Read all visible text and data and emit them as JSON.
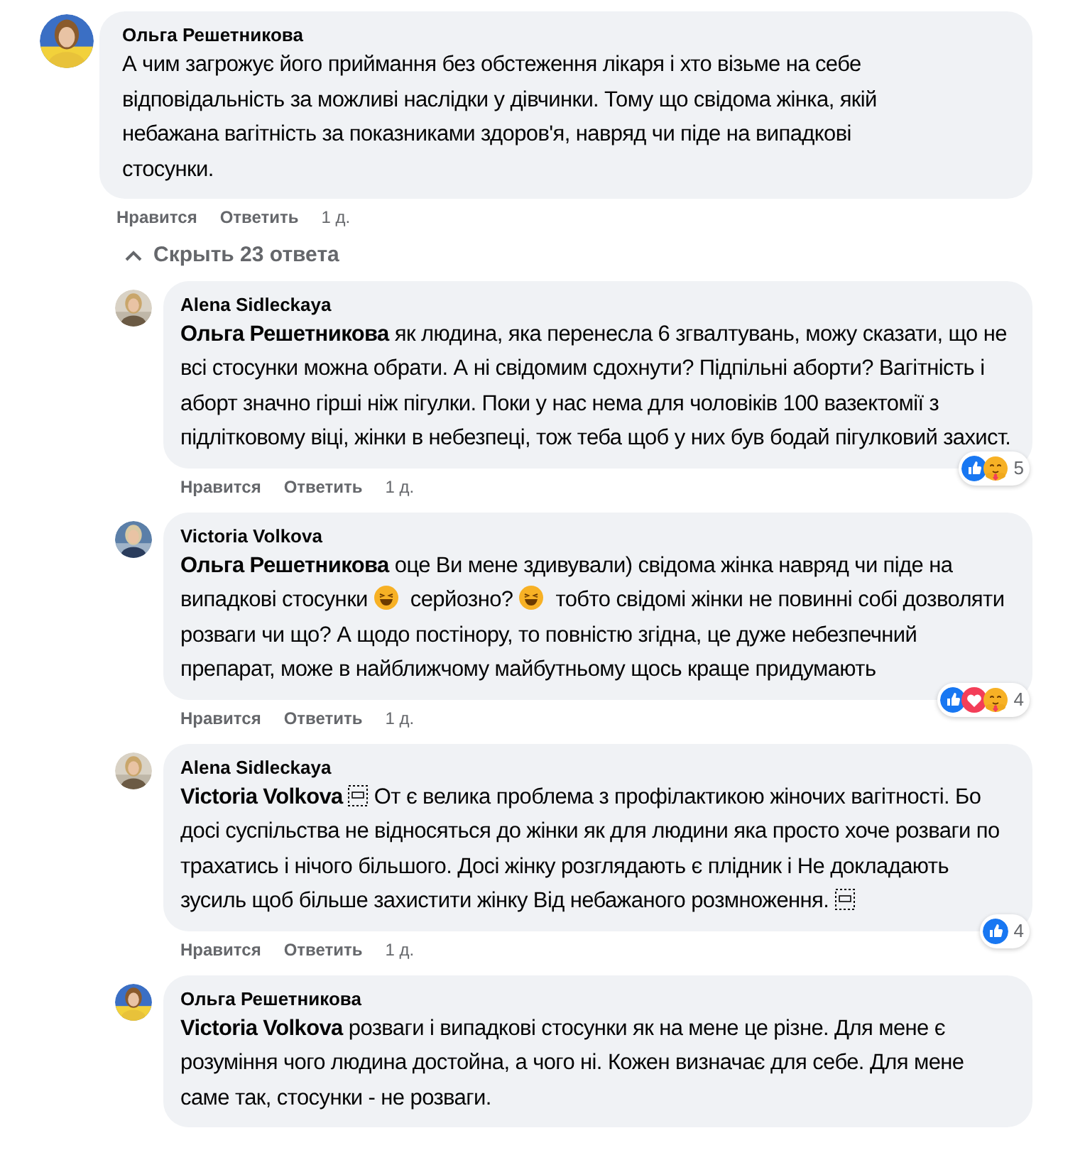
{
  "comment": {
    "author": "Ольга Решетникова",
    "body": [
      {
        "kind": "text",
        "text": "А чим загрожує його приймання без обстеження лікаря і хто візьме на себе відповідальність за можливі наслідки у дівчинки. Тому що свідома жінка, якій небажана вагітність за показниками здоров'я, навряд чи піде на випадкові стосунки."
      }
    ],
    "actions": [
      "Нравится",
      "Ответить"
    ],
    "time": "1 д."
  },
  "replies_toggle": {
    "label": "Скрыть 23 ответа",
    "expanded": true
  },
  "replies": [
    {
      "author": "Alena Sidleckaya",
      "body": [
        {
          "kind": "mention",
          "text": "Ольга Решетникова"
        },
        {
          "kind": "text",
          "text": " як людина, яка перенесла 6 згвалтувань, можу сказати, що не всі стосунки можна обрати. А ні свідомим сдохнути? Підпільні аборти? Вагітність і аборт значно гірші ніж пігулки. Поки у нас нема для чоловіків 100 вазектомії з підлітковому віці, жінки в небезпеці, тож теба щоб у них був бодай пігулковий захист."
        }
      ],
      "actions": [
        "Нравится",
        "Ответить"
      ],
      "time": "1 д.",
      "reactions": {
        "items": [
          {
            "kind": "like"
          },
          {
            "kind": "care"
          }
        ],
        "count": "5"
      }
    },
    {
      "author": "Victoria Volkova",
      "body": [
        {
          "kind": "mention",
          "text": "Ольга Решетникова"
        },
        {
          "kind": "text",
          "text": " оце Ви мене здивували) свідома жінка навряд чи піде на випадкові стосунки"
        },
        {
          "kind": "emoji"
        },
        {
          "kind": "text",
          "text": " серйозно?"
        },
        {
          "kind": "emoji"
        },
        {
          "kind": "text",
          "text": " тобто свідомі жінки не повинні собі дозволяти розваги чи що? А щодо постінору, то повністю згідна, це дуже небезпечний препарат, може в найближчому майбутньому щось краще придумають"
        }
      ],
      "actions": [
        "Нравится",
        "Ответить"
      ],
      "time": "1 д.",
      "reactions": {
        "items": [
          {
            "kind": "like"
          },
          {
            "kind": "love"
          },
          {
            "kind": "care"
          }
        ],
        "count": "4"
      }
    },
    {
      "author": "Alena Sidleckaya",
      "body": [
        {
          "kind": "mention",
          "text": "Victoria Volkova"
        },
        {
          "kind": "object"
        },
        {
          "kind": "text",
          "text": " От є велика проблема з профілактикою жіночих вагітності. Бо досі суспільства не відносяться до жінки як для людини яка просто хоче розваги по трахатись і нічого більшого. Досі жінку розглядають є плідник і Не докладають зусиль щоб більше захистити жінку Від небажаного розмноження."
        },
        {
          "kind": "object"
        }
      ],
      "actions": [
        "Нравится",
        "Ответить"
      ],
      "time": "1 д.",
      "reactions": {
        "items": [
          {
            "kind": "like"
          }
        ],
        "count": "4"
      }
    },
    {
      "author": "Ольга Решетникова",
      "body": [
        {
          "kind": "mention",
          "text": "Victoria Volkova"
        },
        {
          "kind": "text",
          "text": " розваги і випадкові стосунки як на мене це різне. Для мене є розуміння чого людина достойна, а чого ні. Кожен визначає для себе. Для мене саме так, стосунки - не розваги."
        }
      ]
    }
  ]
}
